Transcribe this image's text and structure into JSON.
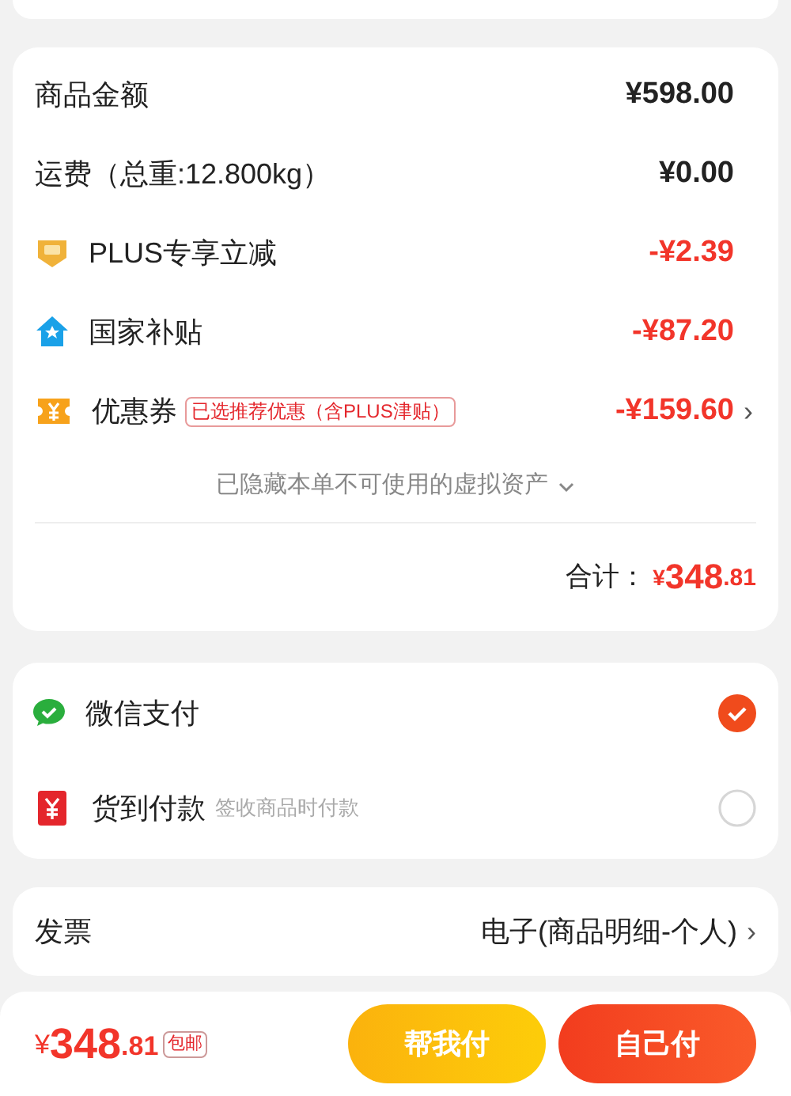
{
  "summary": {
    "rows": [
      {
        "kind": "plain",
        "label": "商品金额",
        "amount": "¥598.00"
      },
      {
        "kind": "plain",
        "label": "运费（总重:12.800kg）",
        "amount": "¥0.00"
      },
      {
        "kind": "plus",
        "label": "PLUS专享立减",
        "amount": "-¥2.39"
      },
      {
        "kind": "subsidy",
        "label": "国家补贴",
        "amount": "-¥87.20"
      },
      {
        "kind": "coupon",
        "label": "优惠券",
        "tag": "已选推荐优惠（含PLUS津贴）",
        "amount": "-¥159.60",
        "chevron": "›"
      }
    ],
    "hidden_note": "已隐藏本单不可使用的虚拟资产",
    "total": {
      "label": "合计：",
      "currency": "¥",
      "integer": "348",
      "decimal": ".81"
    }
  },
  "payment": [
    {
      "kind": "wechat",
      "label": "微信支付",
      "selected": true
    },
    {
      "kind": "cod",
      "label": "货到付款",
      "note": "签收商品时付款",
      "selected": false
    }
  ],
  "invoice": {
    "label": "发票",
    "value": "电子(商品明细-个人)",
    "chevron": "›"
  },
  "bottom_bar": {
    "currency": "¥",
    "integer": "348",
    "decimal": ".81",
    "badge": "包邮",
    "buttons": [
      {
        "kind": "secondary",
        "label": "帮我付"
      },
      {
        "kind": "primary",
        "label": "自己付"
      }
    ]
  }
}
